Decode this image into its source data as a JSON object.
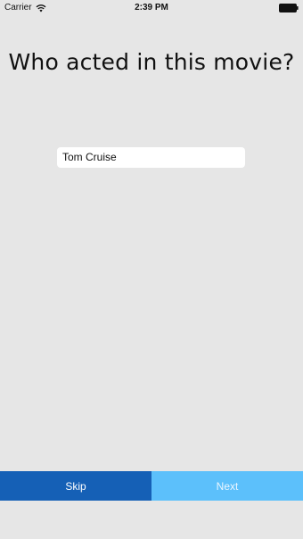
{
  "status_bar": {
    "carrier": "Carrier",
    "time": "2:39 PM",
    "wifi_icon": "wifi-icon",
    "battery_icon": "battery-icon"
  },
  "question": {
    "title": "Who acted in this movie?"
  },
  "answer": {
    "value": "Tom Cruise"
  },
  "buttons": {
    "skip_label": "Skip",
    "next_label": "Next"
  },
  "colors": {
    "background": "#e6e6e6",
    "skip": "#1560b6",
    "next": "#5cc0fb"
  }
}
